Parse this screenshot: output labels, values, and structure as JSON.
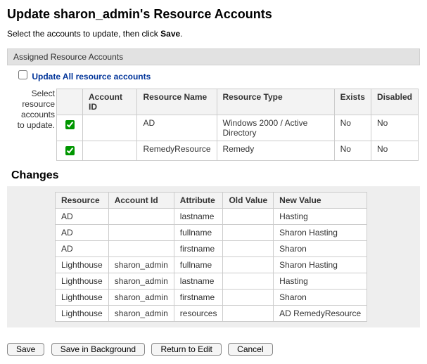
{
  "title": "Update sharon_admin's Resource Accounts",
  "instruction_prefix": "Select the accounts to update, then click ",
  "instruction_bold": "Save",
  "instruction_suffix": ".",
  "panel_header": "Assigned Resource Accounts",
  "update_all_label": "Update All resource accounts",
  "select_label": "Select resource accounts to update.",
  "accounts_table": {
    "headers": [
      "Account ID",
      "Resource Name",
      "Resource Type",
      "Exists",
      "Disabled"
    ],
    "rows": [
      {
        "checked": true,
        "account_id": "",
        "resource_name": "AD",
        "resource_type": "Windows 2000 / Active Directory",
        "exists": "No",
        "disabled": "No"
      },
      {
        "checked": true,
        "account_id": "",
        "resource_name": "RemedyResource",
        "resource_type": "Remedy",
        "exists": "No",
        "disabled": "No"
      }
    ]
  },
  "changes_heading": "Changes",
  "changes_table": {
    "headers": [
      "Resource",
      "Account Id",
      "Attribute",
      "Old Value",
      "New Value"
    ],
    "rows": [
      {
        "resource": "AD",
        "account_id": "",
        "attribute": "lastname",
        "old": "",
        "new": "Hasting"
      },
      {
        "resource": "AD",
        "account_id": "",
        "attribute": "fullname",
        "old": "",
        "new": "Sharon Hasting"
      },
      {
        "resource": "AD",
        "account_id": "",
        "attribute": "firstname",
        "old": "",
        "new": "Sharon"
      },
      {
        "resource": "Lighthouse",
        "account_id": "sharon_admin",
        "attribute": "fullname",
        "old": "",
        "new": "Sharon Hasting"
      },
      {
        "resource": "Lighthouse",
        "account_id": "sharon_admin",
        "attribute": "lastname",
        "old": "",
        "new": "Hasting"
      },
      {
        "resource": "Lighthouse",
        "account_id": "sharon_admin",
        "attribute": "firstname",
        "old": "",
        "new": "Sharon"
      },
      {
        "resource": "Lighthouse",
        "account_id": "sharon_admin",
        "attribute": "resources",
        "old": "",
        "new": "AD RemedyResource"
      }
    ]
  },
  "buttons": {
    "save": "Save",
    "save_bg": "Save in Background",
    "return": "Return to Edit",
    "cancel": "Cancel"
  }
}
